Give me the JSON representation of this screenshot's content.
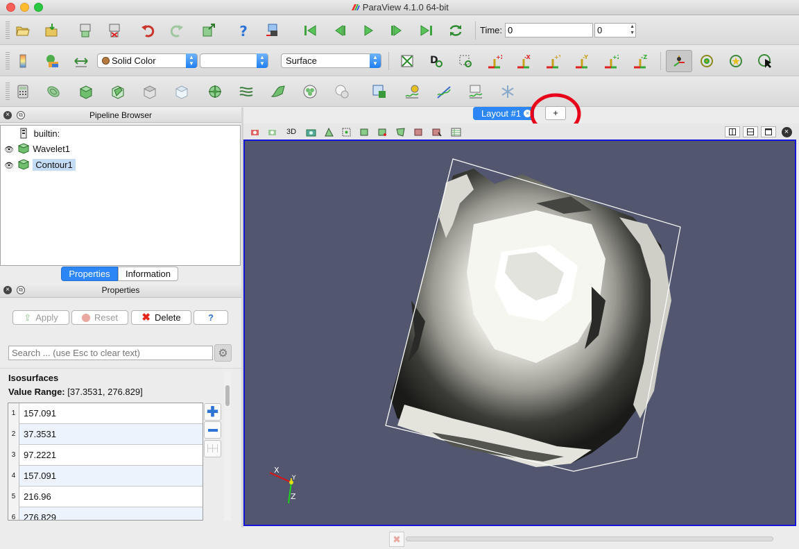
{
  "window": {
    "title": "ParaView 4.1.0 64-bit"
  },
  "colors": {
    "accent": "#2d86f5",
    "view_bg": "#52576f",
    "view_border": "#1414d8",
    "annotation": "#e8001b"
  },
  "toolbar_main": {
    "time_label": "Time:",
    "time_value": "0",
    "timestep_value": "0"
  },
  "toolbar_display": {
    "color_by": "Solid Color",
    "component": "",
    "representation": "Surface",
    "d_label": "D"
  },
  "camera_buttons": [
    "+X",
    "-X",
    "+Y",
    "-Y",
    "+Z",
    "-Z"
  ],
  "pipeline_browser": {
    "title": "Pipeline Browser",
    "items": [
      {
        "label": "builtin:",
        "icon": "server-icon"
      },
      {
        "label": "Wavelet1",
        "icon": "cube-icon"
      },
      {
        "label": "Contour1",
        "icon": "cube-icon"
      }
    ]
  },
  "panel_tabs": {
    "properties": "Properties",
    "information": "Information"
  },
  "properties": {
    "title": "Properties",
    "apply": "Apply",
    "reset": "Reset",
    "delete": "Delete",
    "help": "?",
    "search_placeholder": "Search ... (use Esc to clear text)",
    "section": "Isosurfaces",
    "value_range_label": "Value Range:",
    "value_range": "[37.3531, 276.829]",
    "iso_values": [
      {
        "index": "1",
        "value": "157.091"
      },
      {
        "index": "2",
        "value": "37.3531"
      },
      {
        "index": "3",
        "value": "97.2221"
      },
      {
        "index": "4",
        "value": "157.091"
      },
      {
        "index": "5",
        "value": "216.96"
      },
      {
        "index": "6",
        "value": "276.829"
      }
    ]
  },
  "layout_tabs": {
    "active": "Layout #1",
    "add": "+"
  },
  "view_toolbar": {
    "label_3d": "3D"
  },
  "axes": {
    "x": "X",
    "y": "Y",
    "z": "Z"
  }
}
